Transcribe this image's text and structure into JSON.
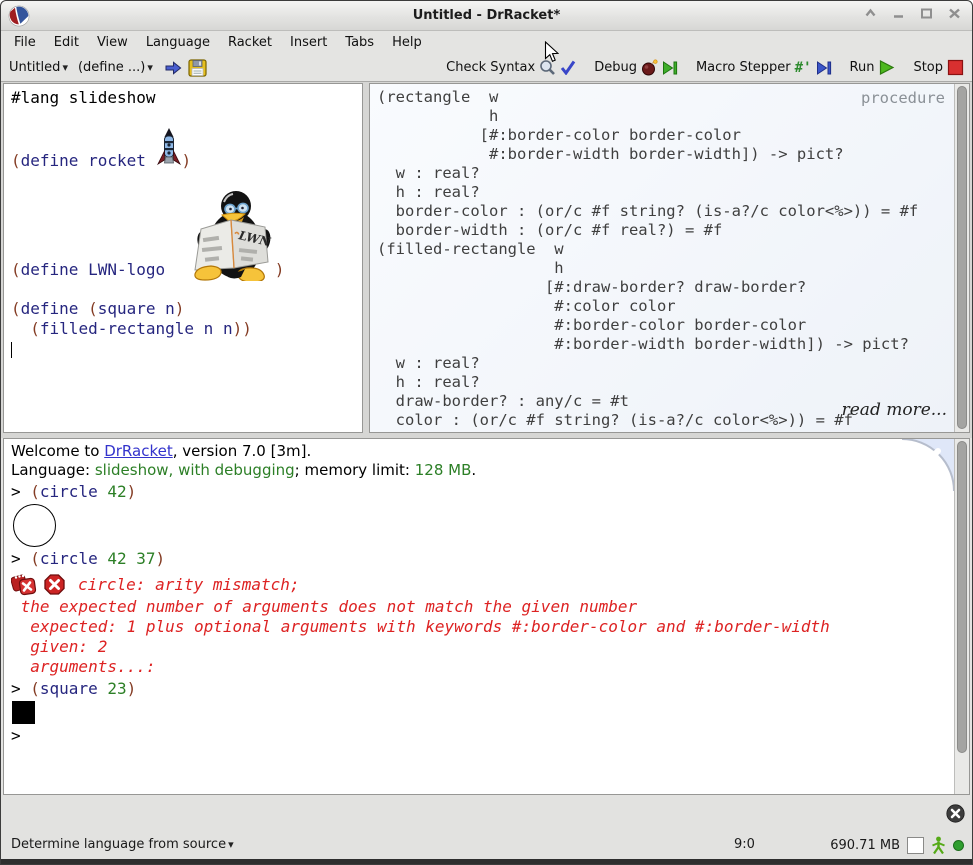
{
  "window": {
    "title": "Untitled - DrRacket*"
  },
  "icons": {
    "dropdown_arrow": "▾"
  },
  "colors": {
    "paren": "#843c24",
    "identifier": "#26267f",
    "number": "#2c7f26",
    "error": "#dd2222",
    "link": "#3333cc",
    "language_green": "#2c7f26",
    "run_green": "#4db81e",
    "stop_red": "#d93030"
  },
  "menu": {
    "items": [
      "File",
      "Edit",
      "View",
      "Language",
      "Racket",
      "Insert",
      "Tabs",
      "Help"
    ]
  },
  "toolbar": {
    "file_dropdown": "Untitled",
    "define_dropdown": "(define ...)",
    "check_syntax": "Check Syntax",
    "debug": "Debug",
    "macro_stepper": "Macro Stepper",
    "run": "Run",
    "stop": "Stop"
  },
  "definitions": {
    "lang_line": [
      [
        "k",
        "#lang slideshow"
      ]
    ],
    "rocket_before": [
      [
        "p",
        "("
      ],
      [
        "s",
        "define"
      ],
      [
        "k",
        " "
      ],
      [
        "s",
        "rocket"
      ],
      [
        "k",
        " "
      ]
    ],
    "rocket_after": [
      [
        "p",
        ")"
      ]
    ],
    "lwn_before": [
      [
        "p",
        "("
      ],
      [
        "s",
        "define"
      ],
      [
        "k",
        " "
      ],
      [
        "s",
        "LWN-logo"
      ],
      [
        "k",
        " "
      ]
    ],
    "lwn_after": [
      [
        "p",
        ")"
      ]
    ],
    "square_line": [
      [
        "p",
        "("
      ],
      [
        "s",
        "define"
      ],
      [
        "k",
        " "
      ],
      [
        "p",
        "("
      ],
      [
        "s",
        "square"
      ],
      [
        "k",
        " "
      ],
      [
        "s",
        "n"
      ],
      [
        "p",
        ")"
      ]
    ],
    "filled_line": [
      [
        "k",
        "  "
      ],
      [
        "p",
        "("
      ],
      [
        "s",
        "filled-rectangle"
      ],
      [
        "k",
        " "
      ],
      [
        "s",
        "n"
      ],
      [
        "k",
        " "
      ],
      [
        "s",
        "n"
      ],
      [
        "p",
        "))"
      ]
    ]
  },
  "docs": {
    "procedure_label": "procedure",
    "read_more": "read more...",
    "lines": [
      "(rectangle  w",
      "            h",
      "           [#:border-color border-color",
      "            #:border-width border-width]) -> pict?",
      "  w : real?",
      "  h : real?",
      "  border-color : (or/c #f string? (is-a?/c color<%>)) = #f",
      "  border-width : (or/c #f real?) = #f",
      "(filled-rectangle  w",
      "                   h",
      "                  [#:draw-border? draw-border?",
      "                   #:color color",
      "                   #:border-color border-color",
      "                   #:border-width border-width]) -> pict?",
      "  w : real?",
      "  h : real?",
      "  draw-border? : any/c = #t",
      "  color : (or/c #f string? (is-a?/c color<%>)) = #f"
    ]
  },
  "repl": {
    "welcome_prefix": "Welcome to ",
    "welcome_link": "DrRacket",
    "welcome_suffix": ", version 7.0 [3m].",
    "lang_prefix": "Language: ",
    "lang_name": "slideshow, with debugging",
    "lang_mid": "; memory limit: ",
    "lang_mem": "128 MB",
    "lang_end": ".",
    "entry1": [
      [
        "k",
        "> "
      ],
      [
        "p",
        "("
      ],
      [
        "s",
        "circle"
      ],
      [
        "k",
        " "
      ],
      [
        "n",
        "42"
      ],
      [
        "p",
        ")"
      ]
    ],
    "entry2": [
      [
        "k",
        "> "
      ],
      [
        "p",
        "("
      ],
      [
        "s",
        "circle"
      ],
      [
        "k",
        " "
      ],
      [
        "n",
        "42"
      ],
      [
        "k",
        " "
      ],
      [
        "n",
        "37"
      ],
      [
        "p",
        ")"
      ]
    ],
    "error_title": "circle: arity mismatch;",
    "error_lines": [
      " the expected number of arguments does not match the given number",
      "  expected: 1 plus optional arguments with keywords #:border-color and #:border-width",
      "  given: 2",
      "  arguments...:"
    ],
    "entry3": [
      [
        "k",
        "> "
      ],
      [
        "p",
        "("
      ],
      [
        "s",
        "square"
      ],
      [
        "k",
        " "
      ],
      [
        "n",
        "23"
      ],
      [
        "p",
        ")"
      ]
    ],
    "prompt": ">"
  },
  "statusbar": {
    "language_menu": "Determine language from source",
    "line_col": "9:0",
    "memory": "690.71 MB"
  }
}
